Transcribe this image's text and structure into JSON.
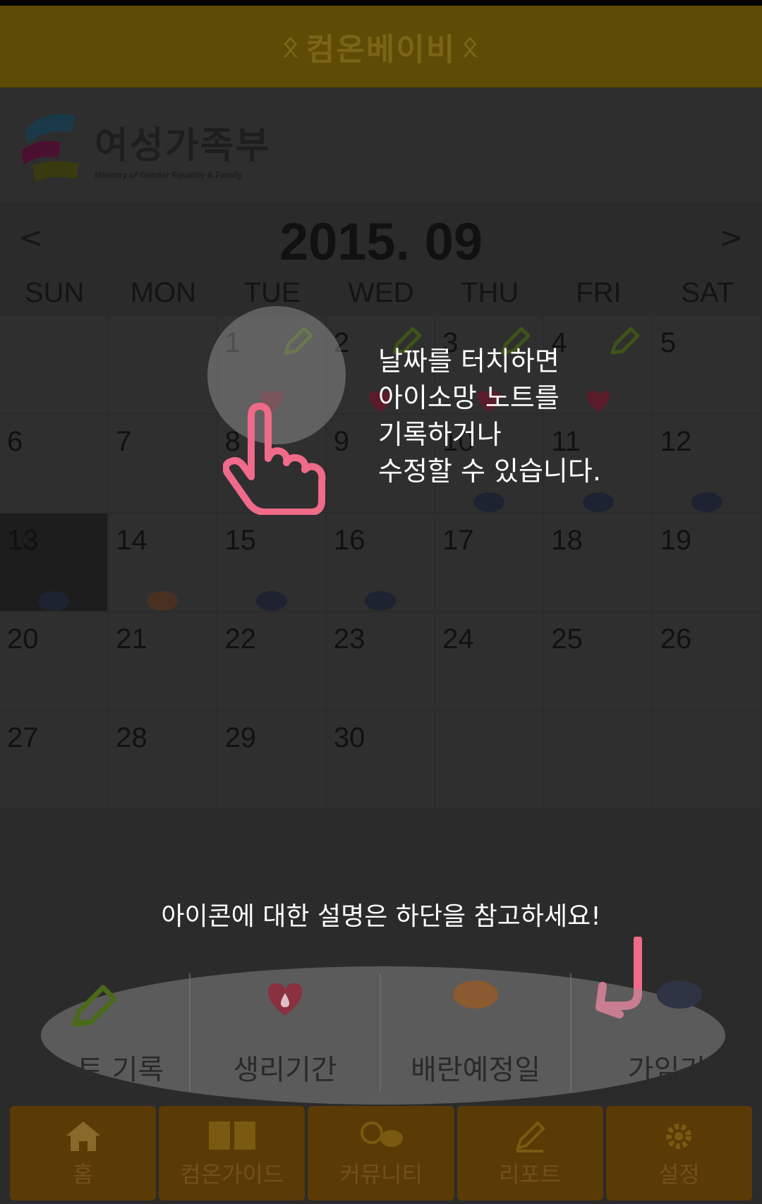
{
  "app": {
    "title": "컴온베이비",
    "accent": "#5e4b05"
  },
  "logo": {
    "name_ko": "여성가족부",
    "name_en": "Ministry of Gender Equality & Family"
  },
  "calendar": {
    "month_title": "2015. 09",
    "prev_label": "<",
    "next_label": ">",
    "weekdays": [
      "SUN",
      "MON",
      "TUE",
      "WED",
      "THU",
      "FRI",
      "SAT"
    ],
    "today": "13",
    "days": [
      "",
      "",
      "1",
      "2",
      "3",
      "4",
      "5",
      "6",
      "7",
      "8",
      "9",
      "10",
      "11",
      "12",
      "13",
      "14",
      "15",
      "16",
      "17",
      "18",
      "19",
      "20",
      "21",
      "22",
      "23",
      "24",
      "25",
      "26",
      "27",
      "28",
      "29",
      "30",
      "",
      "",
      ""
    ]
  },
  "tooltip": {
    "lines": [
      "날짜를 터치하면",
      "아이소망 노트를",
      "기록하거나",
      "수정할 수 있습니다."
    ],
    "bottom_hint": "아이콘에 대한 설명은 하단을 참고하세요!"
  },
  "legend": {
    "items": [
      {
        "label": "망노트 기록",
        "icon": "pencil-icon"
      },
      {
        "label": "생리기간",
        "icon": "heart-drop-icon"
      },
      {
        "label": "배란예정일",
        "icon": "orange-dot-icon"
      },
      {
        "label": "가임기",
        "icon": "blue-dot-icon"
      }
    ]
  },
  "tabs": [
    {
      "label": "홈",
      "icon": "home-icon"
    },
    {
      "label": "컴온가이드",
      "icon": "book-icon"
    },
    {
      "label": "커뮤니티",
      "icon": "chat-icon"
    },
    {
      "label": "리포트",
      "icon": "pen-icon"
    },
    {
      "label": "설정",
      "icon": "gear-icon"
    }
  ]
}
